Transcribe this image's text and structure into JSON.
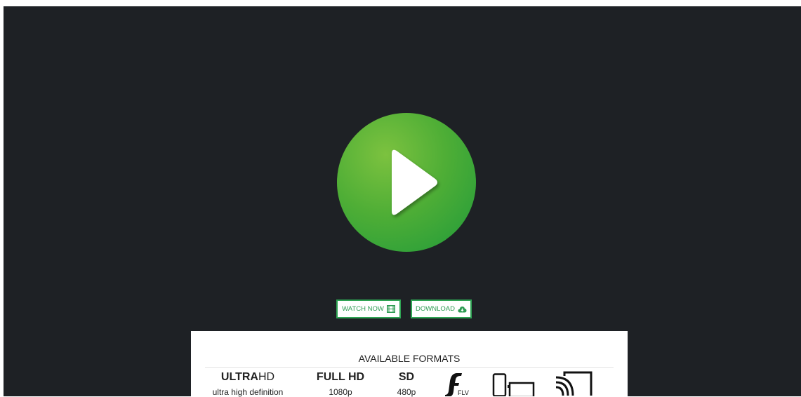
{
  "buttons": {
    "watch_now": "WATCH NOW",
    "download": "DOWNLOAD"
  },
  "formats": {
    "title": "AVAILABLE FORMATS",
    "ultra_hd": {
      "strong": "ULTRA",
      "light": "HD",
      "sub": "ultra high definition"
    },
    "full_hd": {
      "label": "FULL HD",
      "sub": "1080p"
    },
    "sd": {
      "label": "SD",
      "sub": "480p"
    },
    "flv_label": "FLV"
  },
  "icons": {
    "play": "play-icon",
    "watch": "film-icon",
    "download": "cloud-download-icon",
    "flv": "flash-flv-icon",
    "devices": "devices-icon",
    "cast": "cast-icon"
  },
  "colors": {
    "player_bg": "#1e2125",
    "play_green": "#4fae36",
    "button_green": "#2fa454"
  }
}
